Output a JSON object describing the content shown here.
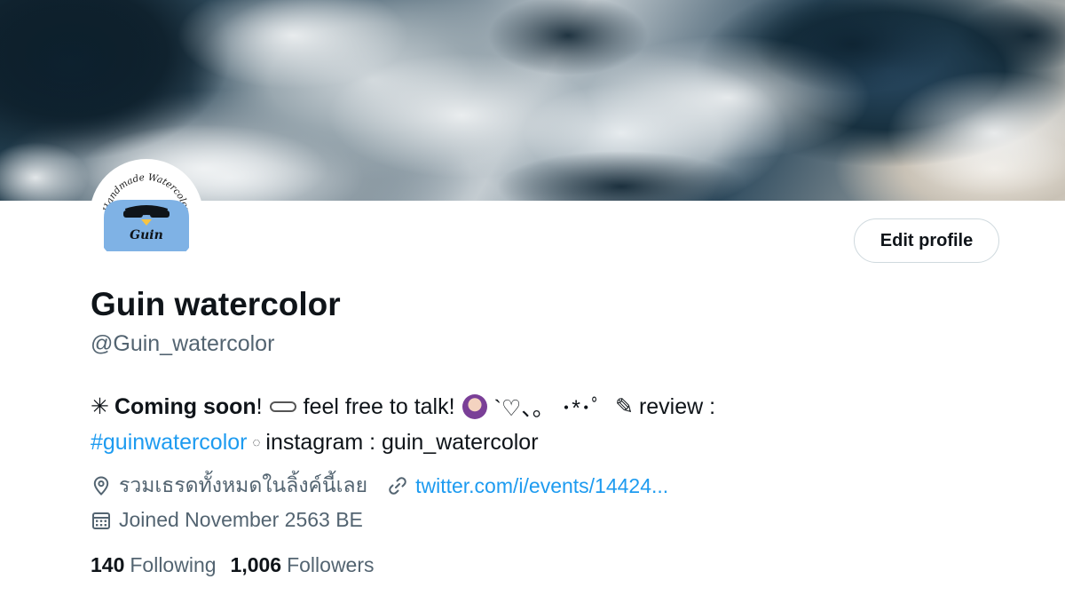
{
  "profile": {
    "display_name": "Guin watercolor",
    "handle": "@Guin_watercolor",
    "edit_profile_label": "Edit profile",
    "avatar": {
      "arc_text": "Handmade Watercolor",
      "name_text": "Guin"
    },
    "bio": {
      "line1": {
        "star": "✳",
        "coming_soon": "Coming soon",
        "exclaim": "!",
        "talk": "feel free to talk!",
        "decor": "`♡、。 ･*･ﾟ",
        "pencil": "✎",
        "review": "review :"
      },
      "line2": {
        "hashtag": "#guinwatercolor",
        "dot": "◌",
        "instagram": "instagram : guin_watercolor"
      }
    },
    "location": "รวมเธรดทั้งหมดในลิ้งค์นี้เลย",
    "website": "twitter.com/i/events/14424...",
    "joined": "Joined November 2563 BE",
    "stats": {
      "following_count": "140",
      "following_label": "Following",
      "followers_count": "1,006",
      "followers_label": "Followers"
    }
  },
  "icons": {
    "location": "location-pin-icon",
    "link": "link-icon",
    "calendar": "calendar-icon"
  },
  "colors": {
    "text_primary": "#0f1419",
    "text_secondary": "#536471",
    "link": "#1d9bf0",
    "button_border": "#cfd9de",
    "avatar_blue": "#7fb2e5"
  }
}
